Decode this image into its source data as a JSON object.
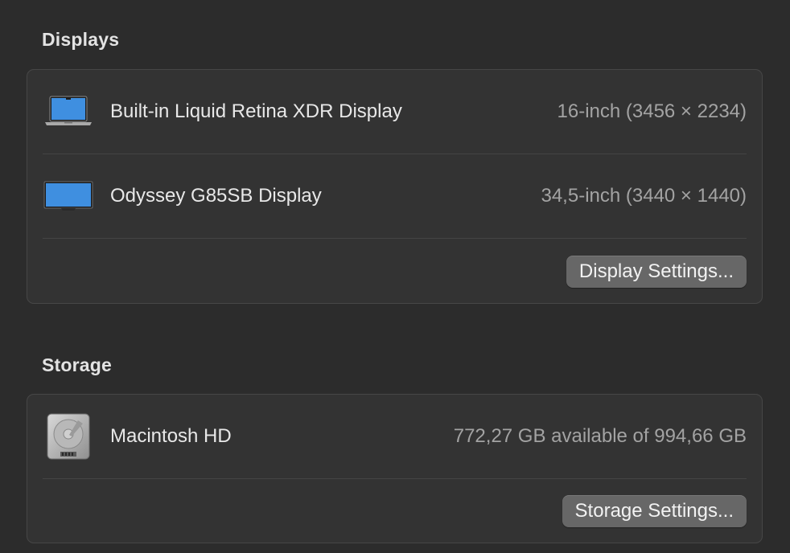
{
  "displays": {
    "title": "Displays",
    "items": [
      {
        "icon": "laptop-icon",
        "name": "Built-in Liquid Retina XDR Display",
        "detail": "16-inch (3456 × 2234)"
      },
      {
        "icon": "monitor-icon",
        "name": "Odyssey G85SB Display",
        "detail": "34,5-inch (3440 × 1440)"
      }
    ],
    "settings_button": "Display Settings..."
  },
  "storage": {
    "title": "Storage",
    "items": [
      {
        "icon": "hard-drive-icon",
        "name": "Macintosh HD",
        "detail": "772,27 GB available of 994,66 GB"
      }
    ],
    "settings_button": "Storage Settings..."
  },
  "colors": {
    "background": "#2c2c2c",
    "panel": "#333333",
    "button": "#676767",
    "screen_blue": "#3f8fe0"
  }
}
